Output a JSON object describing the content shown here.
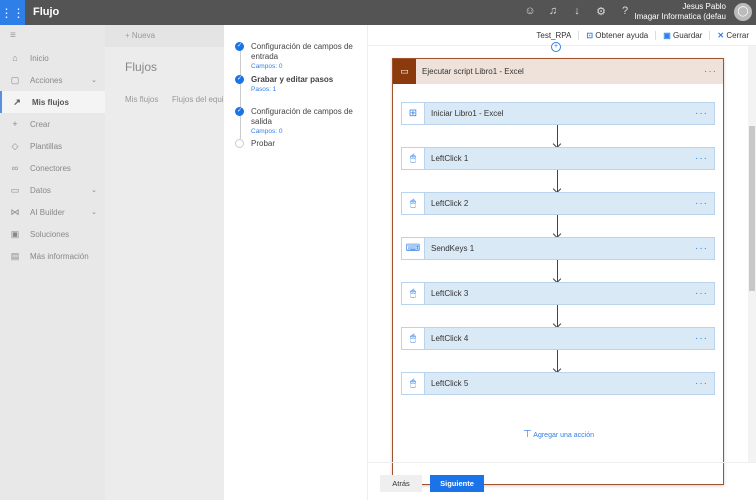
{
  "header": {
    "app": "Flujo",
    "user_name": "Jesus Pablo",
    "org": "Imagar Informatica (defau"
  },
  "sidebar": {
    "items": [
      {
        "label": "Inicio",
        "icon": "⌂"
      },
      {
        "label": "Acciones",
        "icon": "▢",
        "chev": true
      },
      {
        "label": "Mis flujos",
        "icon": "↗",
        "selected": true
      },
      {
        "label": "Crear",
        "icon": "+"
      },
      {
        "label": "Plantillas",
        "icon": "◇"
      },
      {
        "label": "Conectores",
        "icon": "∞"
      },
      {
        "label": "Datos",
        "icon": "▭",
        "chev": true
      },
      {
        "label": "AI Builder",
        "icon": "⋈",
        "chev": true
      },
      {
        "label": "Soluciones",
        "icon": "▣"
      },
      {
        "label": "Más información",
        "icon": "▤"
      }
    ]
  },
  "main": {
    "new_label": "Nueva",
    "title": "Flujos",
    "tabs": [
      "Mis flujos",
      "Flujos del equipo"
    ]
  },
  "wizard": {
    "steps": [
      {
        "title": "Configuración de campos de entrada",
        "sub": "Campos: 0",
        "done": true
      },
      {
        "title": "Grabar y editar pasos",
        "sub": "Pasos: 1",
        "done": true,
        "bold": true
      },
      {
        "title": "Configuración de campos de salida",
        "sub": "Campos: 0",
        "done": true
      },
      {
        "title": "Probar",
        "sub": "",
        "done": false
      }
    ]
  },
  "toolbar": {
    "name": "Test_RPA",
    "help": "Obtener ayuda",
    "save": "Guardar",
    "close": "Cerrar"
  },
  "scope": {
    "title": "Ejecutar script Libro1 - Excel",
    "actions": [
      {
        "label": "Iniciar Libro1 - Excel",
        "icon": "⊞"
      },
      {
        "label": "LeftClick 1",
        "icon": "🖱"
      },
      {
        "label": "LeftClick 2",
        "icon": "🖱"
      },
      {
        "label": "SendKeys 1",
        "icon": "⌨"
      },
      {
        "label": "LeftClick 3",
        "icon": "🖱"
      },
      {
        "label": "LeftClick 4",
        "icon": "🖱"
      },
      {
        "label": "LeftClick 5",
        "icon": "🖱"
      }
    ],
    "add_action": "Agregar una acción",
    "more": "···"
  },
  "footer": {
    "back": "Atrás",
    "next": "Siguiente"
  }
}
